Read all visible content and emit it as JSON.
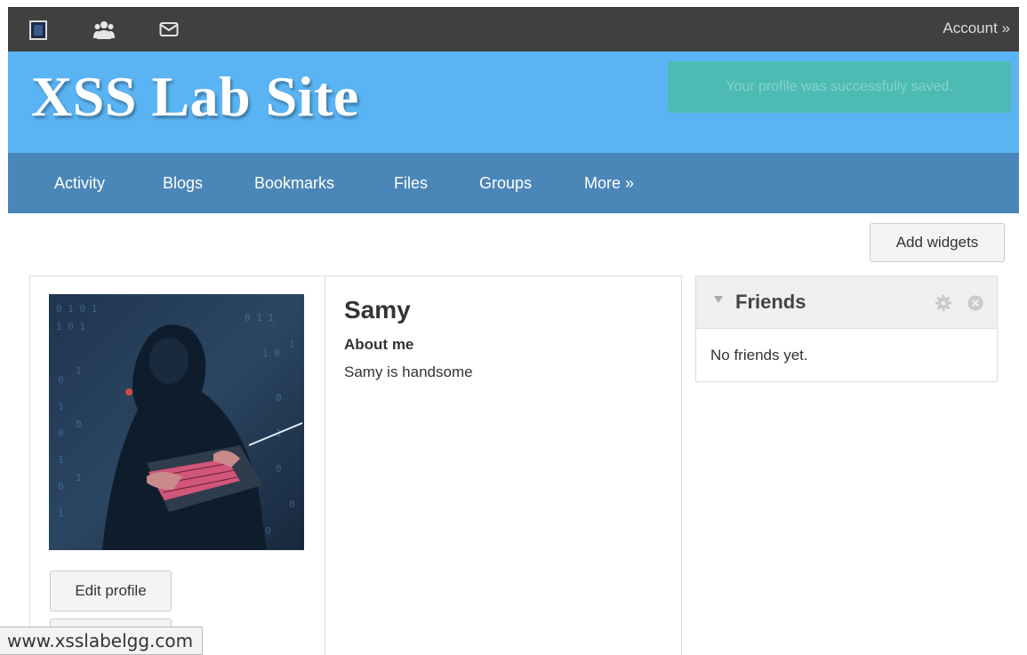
{
  "topbar": {
    "icons": [
      "site-logo-icon",
      "friends-icon",
      "messages-icon"
    ],
    "account_label": "Account »"
  },
  "header": {
    "site_title": "XSS Lab Site",
    "notice": "Your profile was successfully saved."
  },
  "nav": {
    "items": [
      "Activity",
      "Blogs",
      "Bookmarks",
      "Files",
      "Groups",
      "More »"
    ]
  },
  "content": {
    "add_widgets_label": "Add widgets",
    "profile": {
      "name": "Samy",
      "about_label": "About me",
      "about_text": "Samy is handsome",
      "edit_profile_label": "Edit profile"
    },
    "friends_widget": {
      "title": "Friends",
      "empty_text": "No friends yet."
    }
  },
  "statusbar": {
    "url": "www.xsslabelgg.com"
  },
  "colors": {
    "topbar": "#404040",
    "header": "#5ab4f4",
    "nav": "#4b86b8",
    "notice": "#4dbbb4"
  }
}
